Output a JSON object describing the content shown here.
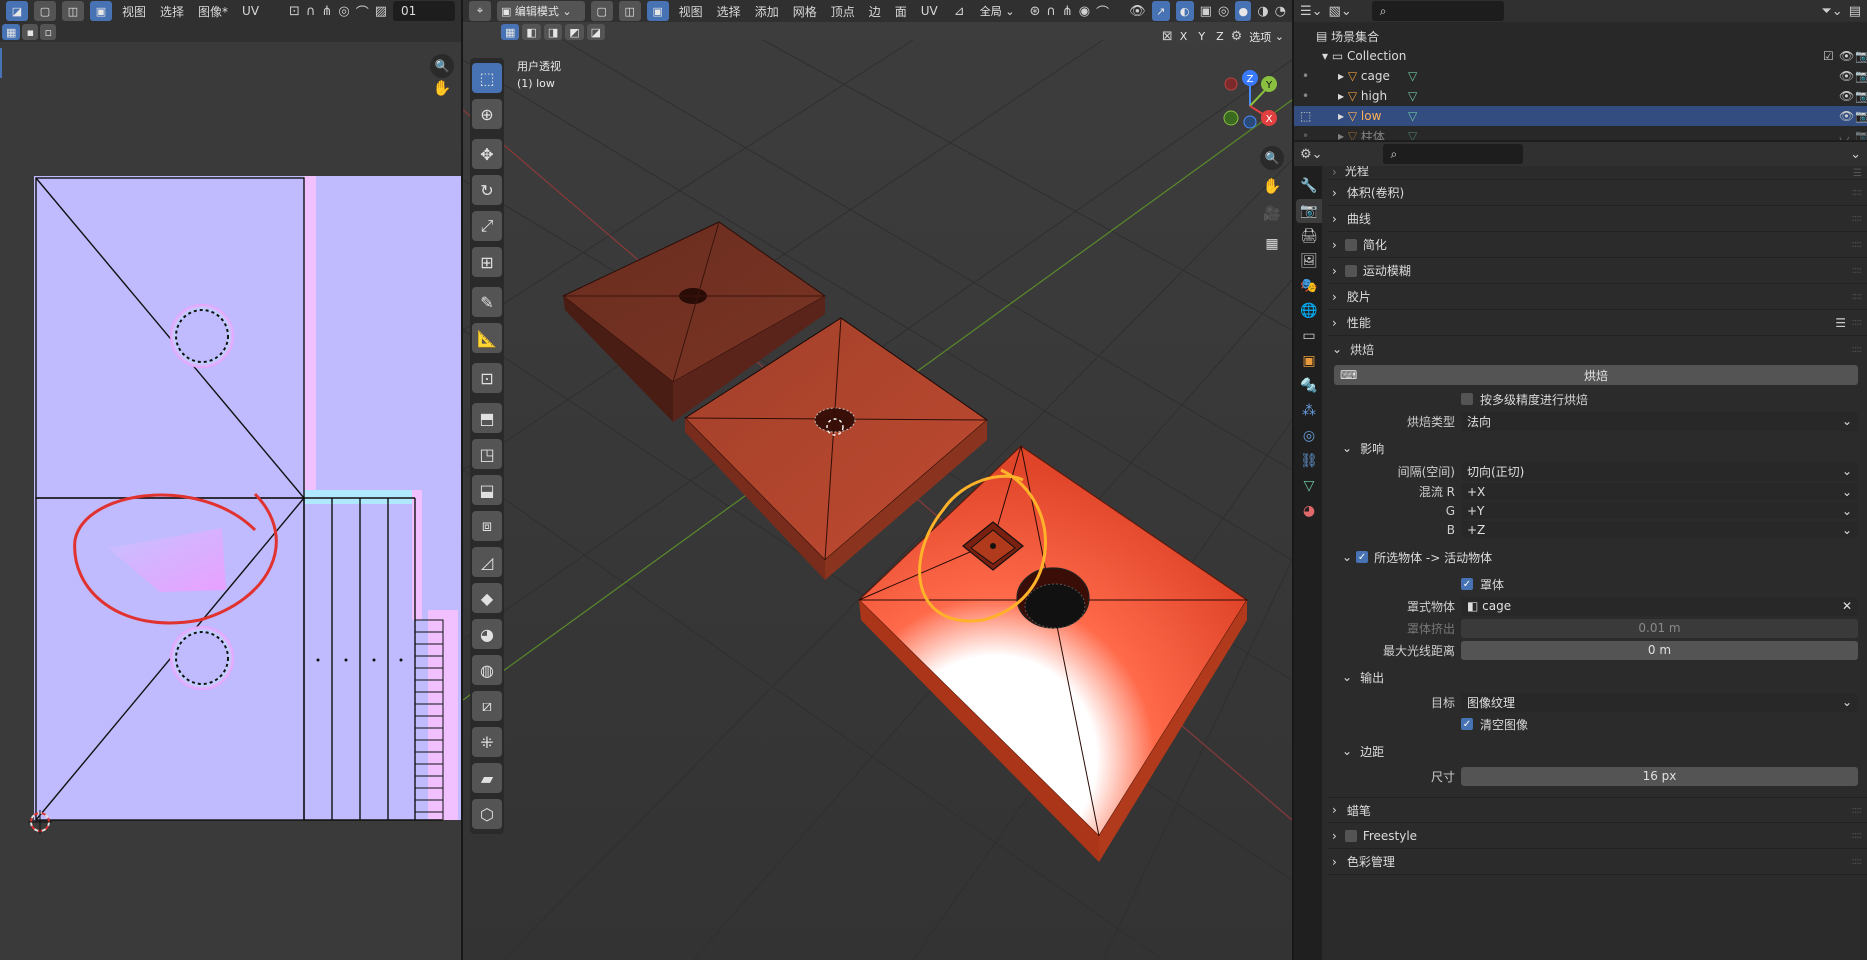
{
  "uv_editor": {
    "menus": [
      "视图",
      "选择",
      "图像*",
      "UV"
    ],
    "image_slot": "01"
  },
  "viewport": {
    "mode": "编辑模式",
    "menus": [
      "视图",
      "选择",
      "添加",
      "网格",
      "顶点",
      "边",
      "面",
      "UV"
    ],
    "transform_orientation": "全局",
    "axis_labels": [
      "X",
      "Y",
      "Z"
    ],
    "options_label": "选项",
    "overlay_title": "用户透视",
    "overlay_object": "(1) low",
    "gizmo": {
      "z": "Z",
      "y": "Y",
      "x": "X"
    }
  },
  "outliner": {
    "scene_collection": "场景集合",
    "collection": "Collection",
    "items": [
      {
        "name": "cage",
        "selected": false,
        "hidden": false
      },
      {
        "name": "high",
        "selected": false,
        "hidden": false
      },
      {
        "name": "low",
        "selected": true,
        "hidden": false
      },
      {
        "name": "柱体",
        "selected": false,
        "hidden": true
      }
    ]
  },
  "properties": {
    "partial_top": "光程",
    "sections_top": [
      "体积(卷积)",
      "曲线",
      "简化",
      "运动模糊",
      "胶片",
      "性能"
    ],
    "bake": {
      "title": "烘焙",
      "bake_button": "烘焙",
      "multires_label": "按多级精度进行烘焙",
      "bake_type_label": "烘焙类型",
      "bake_type_value": "法向",
      "influence_title": "影响",
      "space_label": "间隔(空间)",
      "space_value": "切向(正切)",
      "swizzle_r_label": "混流 R",
      "swizzle_r_value": "+X",
      "swizzle_g_label": "G",
      "swizzle_g_value": "+Y",
      "swizzle_b_label": "B",
      "swizzle_b_value": "+Z",
      "selected_to_active_title": "所选物体 -> 活动物体",
      "cage_label": "罩体",
      "cage_object_label": "罩式物体",
      "cage_object_value": "cage",
      "cage_extrusion_label": "罩体挤出",
      "cage_extrusion_value": "0.01 m",
      "max_ray_label": "最大光线距离",
      "max_ray_value": "0 m",
      "output_title": "输出",
      "target_label": "目标",
      "target_value": "图像纹理",
      "clear_image_label": "清空图像",
      "margin_title": "边距",
      "size_label": "尺寸",
      "size_value": "16 px"
    },
    "sections_bottom": [
      "蜡笔",
      "Freestyle",
      "色彩管理"
    ]
  }
}
